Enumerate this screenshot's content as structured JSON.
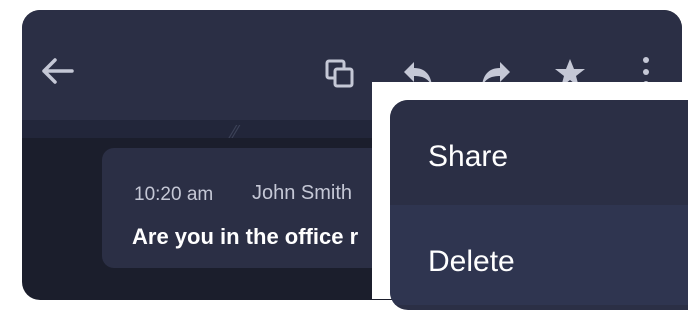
{
  "toolbar": {
    "back_icon": "arrow-back-icon",
    "copy_icon": "copy-icon",
    "reply_icon": "reply-icon",
    "forward_icon": "forward-icon",
    "star_icon": "star-icon",
    "more_icon": "more-vertical-icon"
  },
  "message": {
    "time": "10:20 am",
    "sender": "John Smith",
    "text": "Are you in the office r"
  },
  "menu": {
    "items": [
      {
        "label": "Share"
      },
      {
        "label": "Delete"
      }
    ]
  },
  "colors": {
    "window_bg": "#1b1e2c",
    "toolbar_bg": "#2b2f45",
    "menu_bg": "#2b2f45",
    "menu_hover_bg": "#2f3550",
    "text_primary": "#ffffff",
    "text_secondary": "#c5c8d6"
  }
}
